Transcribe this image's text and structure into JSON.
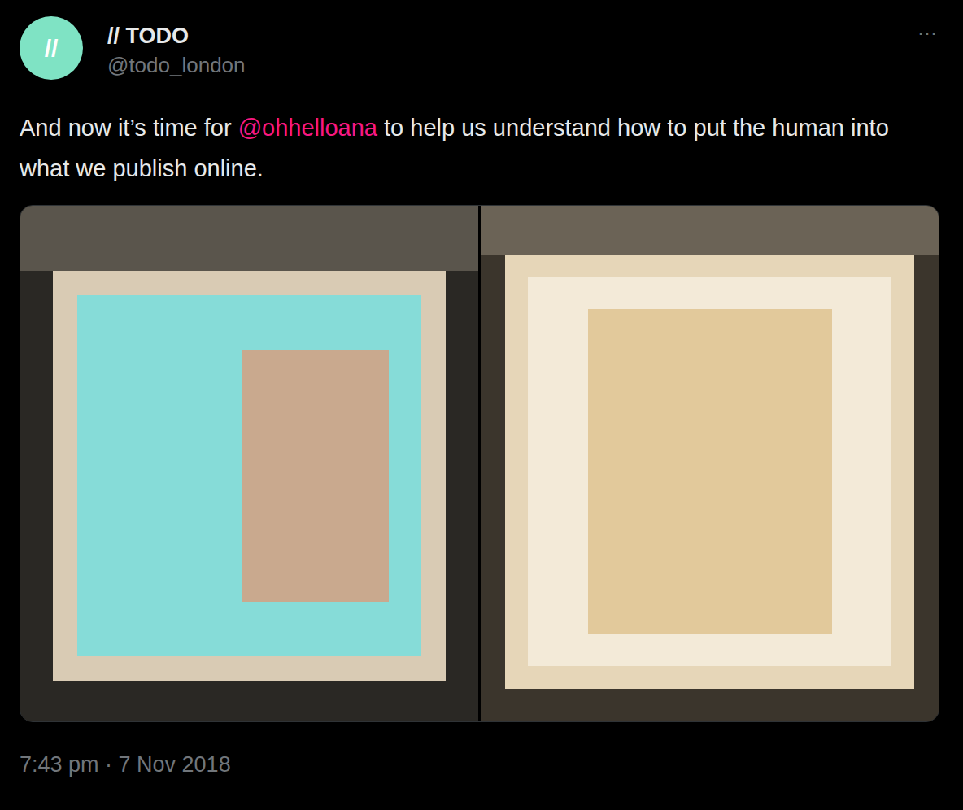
{
  "author": {
    "avatar": "//",
    "name": "// TODO",
    "handle": "@todo_london"
  },
  "more": "···",
  "text": [
    {
      "text": "And now it’s time for ",
      "kind": "plain"
    },
    {
      "text": "@ohhelloana",
      "kind": "mention"
    },
    {
      "text": " to help us understand how to put the human into what we publish online.",
      "kind": "plain"
    }
  ],
  "timestamp": "7:43 pm · 7 Nov 2018"
}
